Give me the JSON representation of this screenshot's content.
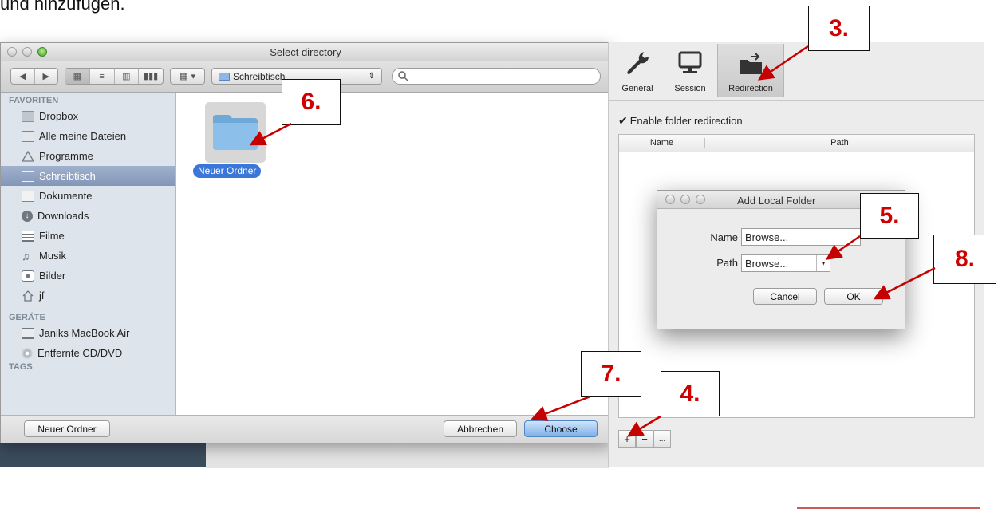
{
  "doc": {
    "top_text": "und hinzufügen."
  },
  "finder": {
    "title": "Select directory",
    "path_popup": "Schreibtisch",
    "sidebar": {
      "favorites_header": "FAVORITEN",
      "favorites": [
        {
          "label": "Dropbox",
          "icon": "folder-icon"
        },
        {
          "label": "Alle meine Dateien",
          "icon": "all-files-icon"
        },
        {
          "label": "Programme",
          "icon": "applications-icon"
        },
        {
          "label": "Schreibtisch",
          "icon": "desktop-icon"
        },
        {
          "label": "Dokumente",
          "icon": "documents-icon"
        },
        {
          "label": "Downloads",
          "icon": "downloads-icon"
        },
        {
          "label": "Filme",
          "icon": "movies-icon"
        },
        {
          "label": "Musik",
          "icon": "music-icon"
        },
        {
          "label": "Bilder",
          "icon": "pictures-icon"
        },
        {
          "label": "jf",
          "icon": "home-icon"
        }
      ],
      "devices_header": "GERÄTE",
      "devices": [
        {
          "label": "Janiks MacBook Air",
          "icon": "laptop-icon"
        },
        {
          "label": "Entfernte CD/DVD",
          "icon": "disc-icon"
        }
      ],
      "tags_header": "TAGS",
      "selected": "Schreibtisch"
    },
    "folder_name": "Neuer Ordner",
    "new_folder_button": "Neuer Ordner",
    "cancel_button": "Abbrechen",
    "choose_button": "Choose"
  },
  "panel": {
    "tabs": [
      {
        "label": "General",
        "icon": "wrench-icon"
      },
      {
        "label": "Session",
        "icon": "monitor-icon"
      },
      {
        "label": "Redirection",
        "icon": "folder-redirect-icon"
      }
    ],
    "active_tab": "Redirection",
    "enable_checkbox": "Enable folder redirection",
    "columns": [
      "Name",
      "Path"
    ],
    "buttons": [
      "+",
      "−",
      "..."
    ]
  },
  "dialog": {
    "title": "Add Local Folder",
    "name_label": "Name",
    "name_value": "Browse...",
    "path_label": "Path",
    "path_value": "Browse...",
    "cancel": "Cancel",
    "ok": "OK"
  },
  "annotations": [
    "3.",
    "4.",
    "5.",
    "6.",
    "7.",
    "8."
  ],
  "colors": {
    "annotation_red": "#d10000",
    "selection_blue": "#3a77d8"
  }
}
